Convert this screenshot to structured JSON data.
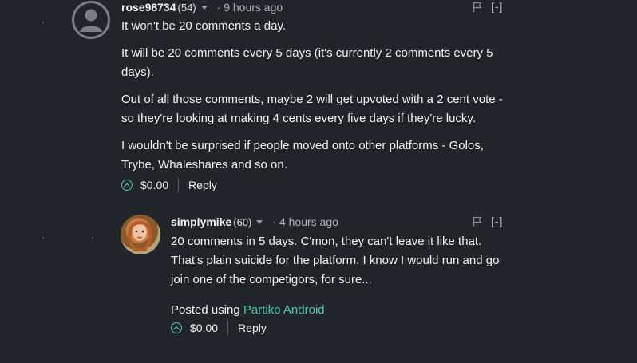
{
  "comments": [
    {
      "author": "rose98734",
      "reputation": "(54)",
      "timestamp": "· 9 hours ago",
      "collapse_label": "[-]",
      "flag_icon": "flag-icon",
      "paragraphs": [
        "It won't be 20 comments a day.",
        "It will be 20 comments every 5 days (it's currently 2 comments every 5 days).",
        "Out of all those comments, maybe 2 will get upvoted with a 2 cent vote - so they're looking at making 4 cents every five days if they're lucky.",
        "I wouldn't be surprised if people moved onto other platforms - Golos, Trybe, Whaleshares and so on."
      ],
      "payout": "$0.00",
      "reply_label": "Reply"
    },
    {
      "author": "simplymike",
      "reputation": "(60)",
      "timestamp": "· 4 hours ago",
      "collapse_label": "[-]",
      "flag_icon": "flag-icon",
      "paragraphs": [
        "20 comments in 5 days. C'mon, they can't leave it like that. That's plain suicide for the platform. I know I would run and go join one of the competigors, for sure..."
      ],
      "posted_using_prefix": "Posted using",
      "posted_using_app": "Partiko Android",
      "payout": "$0.00",
      "reply_label": "Reply"
    }
  ],
  "colors": {
    "background": "#212529",
    "accent": "#4ccba8",
    "muted": "#aeb3b8"
  }
}
